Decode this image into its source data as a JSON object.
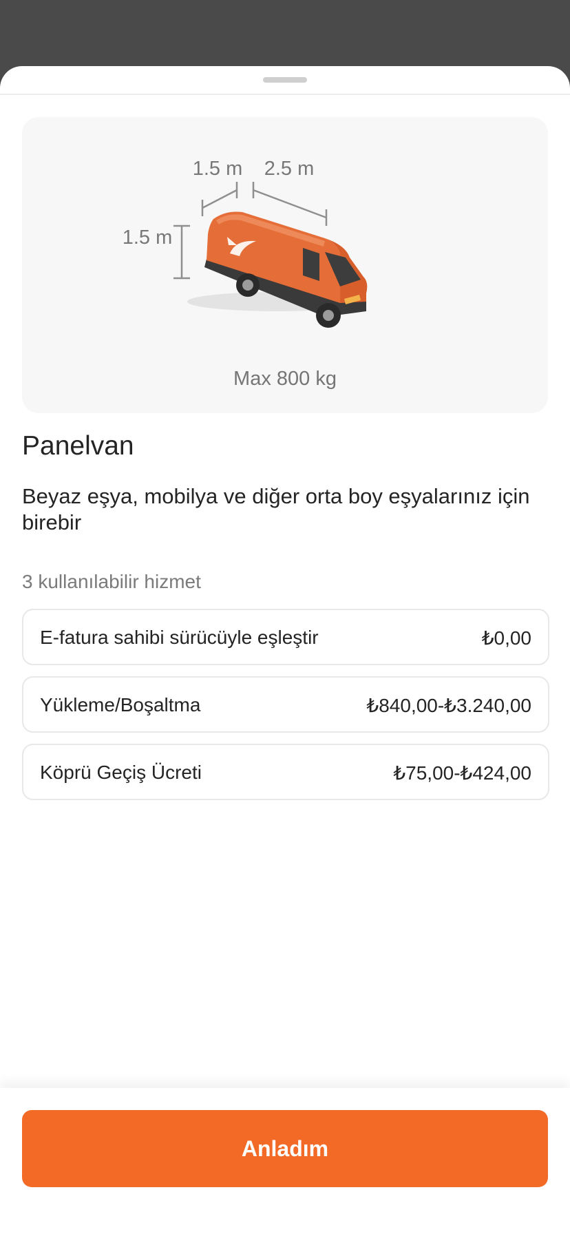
{
  "vehicle": {
    "dimension_depth": "1.5 m",
    "dimension_length": "2.5 m",
    "dimension_height": "1.5 m",
    "capacity": "Max 800 kg",
    "title": "Panelvan",
    "description": "Beyaz eşya, mobilya ve diğer orta boy eşyalarınız için birebir"
  },
  "services": {
    "count_label": "3 kullanılabilir hizmet",
    "items": [
      {
        "name": "E-fatura sahibi sürücüyle eşleştir",
        "price": "₺0,00"
      },
      {
        "name": "Yükleme/Boşaltma",
        "price": "₺840,00-₺3.240,00"
      },
      {
        "name": "Köprü Geçiş Ücreti",
        "price": "₺75,00-₺424,00"
      }
    ]
  },
  "footer": {
    "confirm_label": "Anladım"
  },
  "colors": {
    "accent": "#f36926",
    "van_body": "#e56d37",
    "backdrop": "#4a4a4a"
  }
}
